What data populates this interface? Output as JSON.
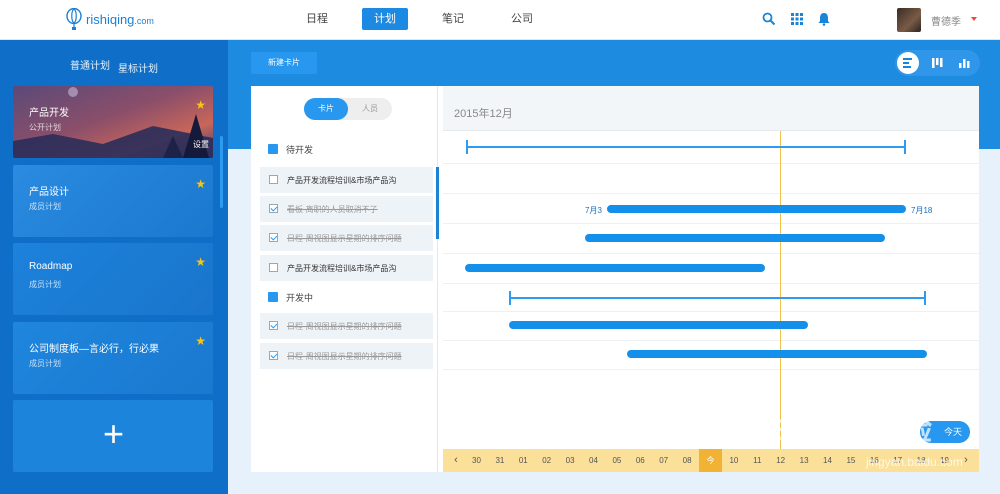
{
  "brand": {
    "name": "rishiqing",
    "suffix": ".com"
  },
  "nav": [
    {
      "label": "日程",
      "active": false
    },
    {
      "label": "计划",
      "active": true
    },
    {
      "label": "笔记",
      "active": false
    },
    {
      "label": "公司",
      "active": false
    }
  ],
  "user": {
    "name": "曹德季"
  },
  "sidebar": {
    "tabs": [
      "普通计划",
      "星标计划"
    ],
    "cards": [
      {
        "title": "产品开发",
        "subtitle": "公开计划",
        "starred": true,
        "action": "设置"
      },
      {
        "title": "产品设计",
        "subtitle": "成员计划",
        "starred": true
      },
      {
        "title": "Roadmap",
        "subtitle": "成员计划",
        "starred": true
      },
      {
        "title": "公司制度板—言必行，行必果",
        "subtitle": "成员计划",
        "starred": true
      }
    ],
    "add_label": "+"
  },
  "toolbar": {
    "new_card_label": "新建卡片"
  },
  "segment": {
    "cards_label": "卡片",
    "members_label": "人员"
  },
  "gantt": {
    "month_label": "2015年12月",
    "groups": [
      {
        "label": "待开发"
      },
      {
        "label": "开发中"
      }
    ],
    "tasks": [
      {
        "label": "产品开发流程培训&市场产品沟",
        "done": false
      },
      {
        "label": "看板-离职的人员取消不了",
        "done": true
      },
      {
        "label": "日程-周视图显示星期的排序问题",
        "done": true
      },
      {
        "label": "产品开发流程培训&市场产品沟",
        "done": false
      },
      {
        "label": "日程-周视图显示星期的排序问题",
        "done": true
      },
      {
        "label": "日程-周视图显示星期的排序问题",
        "done": true
      }
    ],
    "bar_start_label": "7月3",
    "bar_end_label": "7月18",
    "today_button": "今天"
  },
  "timeline": {
    "days": [
      "30",
      "31",
      "01",
      "02",
      "03",
      "04",
      "05",
      "06",
      "07",
      "08",
      "今",
      "10",
      "11",
      "12",
      "13",
      "14",
      "15",
      "16",
      "17",
      "18",
      "19"
    ],
    "today_index": 10
  },
  "watermark": {
    "brand": "Bai du 经验",
    "url": "jingyan.baidu.com"
  },
  "colors": {
    "primary": "#1a85d6",
    "accent": "#2797ef",
    "star": "#f5c518",
    "today": "#f2b233"
  }
}
